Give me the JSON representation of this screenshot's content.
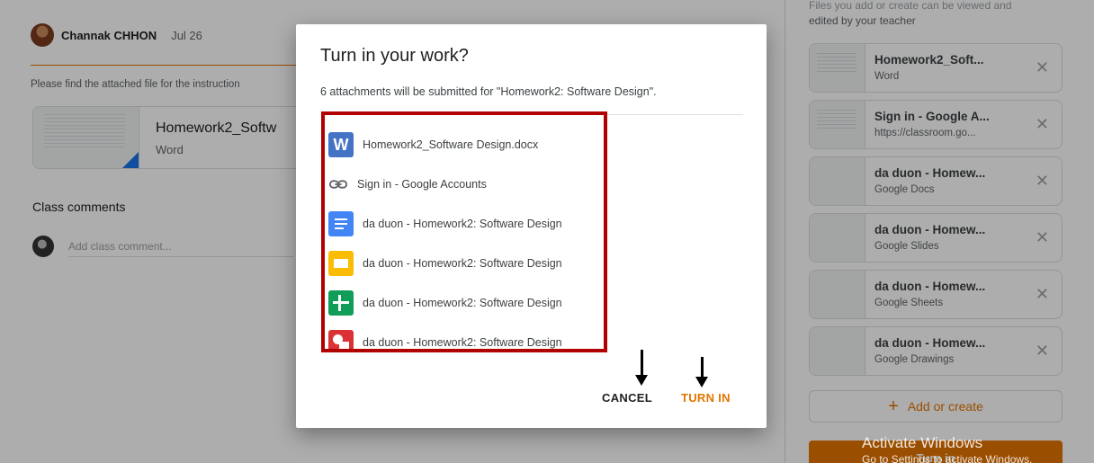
{
  "post": {
    "author": "Channak CHHON",
    "date": "Jul 26",
    "instruction": "Please find the attached file for the instruction",
    "file": {
      "title": "Homework2_Softw",
      "type": "Word"
    },
    "class_comments_label": "Class comments",
    "comment_placeholder": "Add class comment..."
  },
  "sidebar": {
    "note_top": "Files you add or create can be viewed and",
    "note": "edited by your teacher",
    "attachments": [
      {
        "title": "Homework2_Soft...",
        "subtitle": "Word"
      },
      {
        "title": "Sign in - Google A...",
        "subtitle": "https://classroom.go..."
      },
      {
        "title": "da duon - Homew...",
        "subtitle": "Google Docs"
      },
      {
        "title": "da duon - Homew...",
        "subtitle": "Google Slides"
      },
      {
        "title": "da duon - Homew...",
        "subtitle": "Google Sheets"
      },
      {
        "title": "da duon - Homew...",
        "subtitle": "Google Drawings"
      }
    ],
    "close_glyph": "✕",
    "add_or_create": "Add or create",
    "turn_in": "Turn in"
  },
  "watermark": {
    "title": "Activate Windows",
    "subtitle": "Go to Settings to activate Windows."
  },
  "dialog": {
    "title": "Turn in your work?",
    "subtitle": "6 attachments will be submitted for \"Homework2: Software Design\".",
    "items": [
      {
        "icon": "word-icon",
        "label": "Homework2_Software Design.docx"
      },
      {
        "icon": "link-icon",
        "label": "Sign in - Google Accounts"
      },
      {
        "icon": "google-docs-icon",
        "label": "da duon - Homework2: Software Design"
      },
      {
        "icon": "google-slides-icon",
        "label": "da duon - Homework2: Software Design"
      },
      {
        "icon": "google-sheets-icon",
        "label": "da duon - Homework2: Software Design"
      },
      {
        "icon": "google-drawings-icon",
        "label": "da duon - Homework2: Software Design"
      }
    ],
    "word_letter": "W",
    "cancel_label": "CANCEL",
    "turn_in_label": "TURN IN"
  },
  "colors": {
    "accent": "#e37400",
    "highlight_box": "#b00000"
  }
}
